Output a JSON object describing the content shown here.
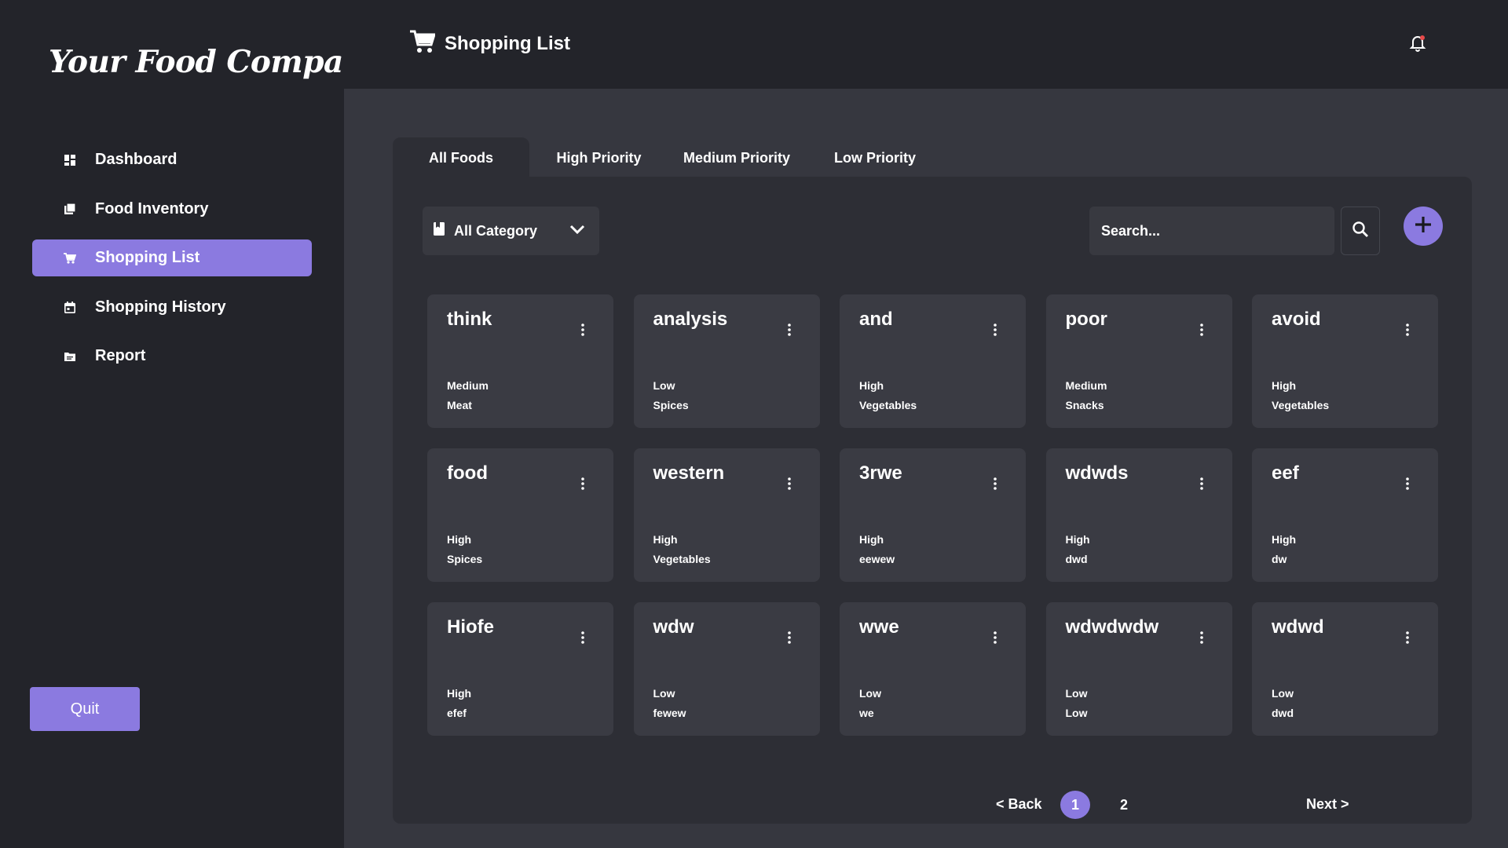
{
  "sidebar": {
    "logo": "Your Food Companion",
    "items": [
      {
        "label": "Dashboard",
        "icon": "dashboard-icon",
        "active": false
      },
      {
        "label": "Food Inventory",
        "icon": "inventory-icon",
        "active": false
      },
      {
        "label": "Shopping List",
        "icon": "cart-icon",
        "active": true
      },
      {
        "label": "Shopping History",
        "icon": "calendar-icon",
        "active": false
      },
      {
        "label": "Report",
        "icon": "report-icon",
        "active": false
      }
    ],
    "quit_label": "Quit"
  },
  "header": {
    "title": "Shopping List",
    "icon": "cart-icon",
    "notification_icon": "bell-icon"
  },
  "tabs": [
    {
      "label": "All Foods",
      "active": true
    },
    {
      "label": "High Priority",
      "active": false
    },
    {
      "label": "Medium Priority",
      "active": false
    },
    {
      "label": "Low Priority",
      "active": false
    }
  ],
  "filter": {
    "category_label": "All Category",
    "search_placeholder": "Search..."
  },
  "cards": [
    {
      "name": "think",
      "priority": "Medium",
      "category": "Meat"
    },
    {
      "name": "analysis",
      "priority": "Low",
      "category": "Spices"
    },
    {
      "name": "and",
      "priority": "High",
      "category": "Vegetables"
    },
    {
      "name": "poor",
      "priority": "Medium",
      "category": "Snacks"
    },
    {
      "name": "avoid",
      "priority": "High",
      "category": "Vegetables"
    },
    {
      "name": "food",
      "priority": "High",
      "category": "Spices"
    },
    {
      "name": "western",
      "priority": "High",
      "category": "Vegetables"
    },
    {
      "name": "3rwe",
      "priority": "High",
      "category": "eewew"
    },
    {
      "name": "wdwds",
      "priority": "High",
      "category": "dwd"
    },
    {
      "name": "eef",
      "priority": "High",
      "category": "dw"
    },
    {
      "name": "Hiofe",
      "priority": "High",
      "category": "efef"
    },
    {
      "name": "wdw",
      "priority": "Low",
      "category": "fewew"
    },
    {
      "name": "wwe",
      "priority": "Low",
      "category": "we"
    },
    {
      "name": "wdwdwdw",
      "priority": "Low",
      "category": "Low"
    },
    {
      "name": "wdwd",
      "priority": "Low",
      "category": "dwd"
    }
  ],
  "pagination": {
    "back_label": "< Back",
    "pages": [
      "1",
      "2"
    ],
    "current_page": "1",
    "next_label": "Next >"
  },
  "colors": {
    "accent": "#8b7ae0",
    "sidebar_bg": "#23242a",
    "main_bg": "#36373f",
    "panel_bg": "#2d2e35",
    "card_bg": "#3a3b43"
  }
}
